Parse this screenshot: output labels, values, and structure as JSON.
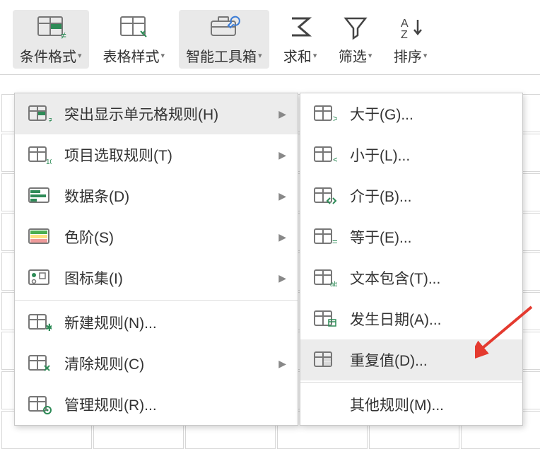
{
  "ribbon": {
    "items": [
      {
        "label": "条件格式",
        "icon": "cf-main",
        "active": true
      },
      {
        "label": "表格样式",
        "icon": "tablestyle",
        "active": false
      },
      {
        "label": "智能工具箱",
        "icon": "toolbox",
        "active": true
      },
      {
        "label": "求和",
        "icon": "sum",
        "active": false
      },
      {
        "label": "筛选",
        "icon": "filter",
        "active": false
      },
      {
        "label": "排序",
        "icon": "sort",
        "active": false
      }
    ]
  },
  "menu1": {
    "items": [
      {
        "label": "突出显示单元格规则(H)",
        "icon": "highlight",
        "hasSub": true,
        "hover": true
      },
      {
        "label": "项目选取规则(T)",
        "icon": "topitems",
        "hasSub": true
      },
      {
        "label": "数据条(D)",
        "icon": "databar",
        "hasSub": true
      },
      {
        "label": "色阶(S)",
        "icon": "colorscale",
        "hasSub": true
      },
      {
        "label": "图标集(I)",
        "icon": "iconset",
        "hasSub": true
      },
      {
        "sep": true
      },
      {
        "label": "新建规则(N)...",
        "icon": "newrule"
      },
      {
        "label": "清除规则(C)",
        "icon": "clearrule",
        "hasSub": true
      },
      {
        "label": "管理规则(R)...",
        "icon": "managerule"
      }
    ]
  },
  "menu2": {
    "items": [
      {
        "label": "大于(G)...",
        "icon": "gt"
      },
      {
        "label": "小于(L)...",
        "icon": "lt"
      },
      {
        "label": "介于(B)...",
        "icon": "between"
      },
      {
        "label": "等于(E)...",
        "icon": "eq"
      },
      {
        "label": "文本包含(T)...",
        "icon": "textcontains"
      },
      {
        "label": "发生日期(A)...",
        "icon": "date"
      },
      {
        "label": "重复值(D)...",
        "icon": "duplicate",
        "hover": true
      },
      {
        "sep": true
      },
      {
        "label": "其他规则(M)...",
        "icon": ""
      }
    ]
  },
  "colors": {
    "accent": "#2e8b57",
    "arrow": "#e43a2f"
  }
}
